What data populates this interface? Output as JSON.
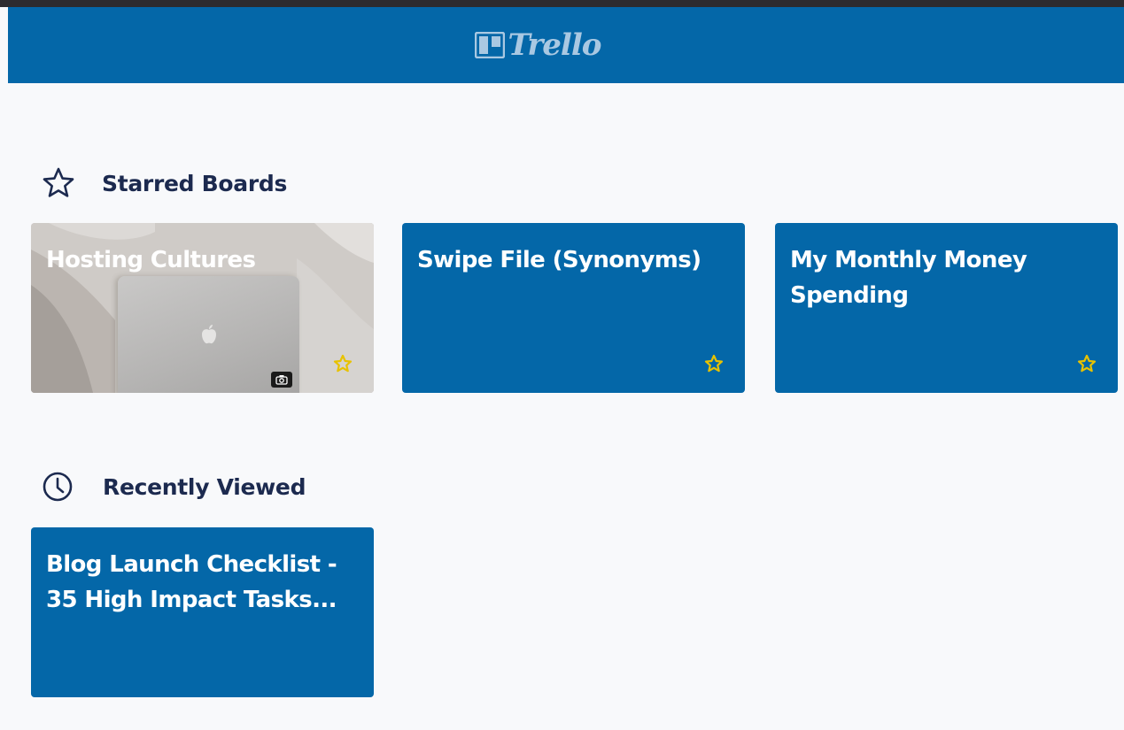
{
  "header": {
    "logo_text": "Trello"
  },
  "starred": {
    "icon": "star-outline-icon",
    "title": "Starred Boards",
    "boards": [
      {
        "title": "Hosting Cultures",
        "background": "photo",
        "starred": true
      },
      {
        "title": "Swipe File (Synonyms)",
        "background": "#0467a8",
        "starred": true
      },
      {
        "title": "My Monthly Money Spending",
        "background": "#0467a8",
        "starred": true
      }
    ]
  },
  "recent": {
    "icon": "clock-icon",
    "title": "Recently Viewed",
    "boards": [
      {
        "title": "Blog Launch Checklist - 35 High Impact Tasks...",
        "background": "#0467a8"
      }
    ]
  },
  "colors": {
    "header": "#0467a8",
    "board": "#0467a8",
    "star": "#e8c200",
    "heading": "#1c2a4f",
    "page_bg": "#f8f9fb"
  }
}
